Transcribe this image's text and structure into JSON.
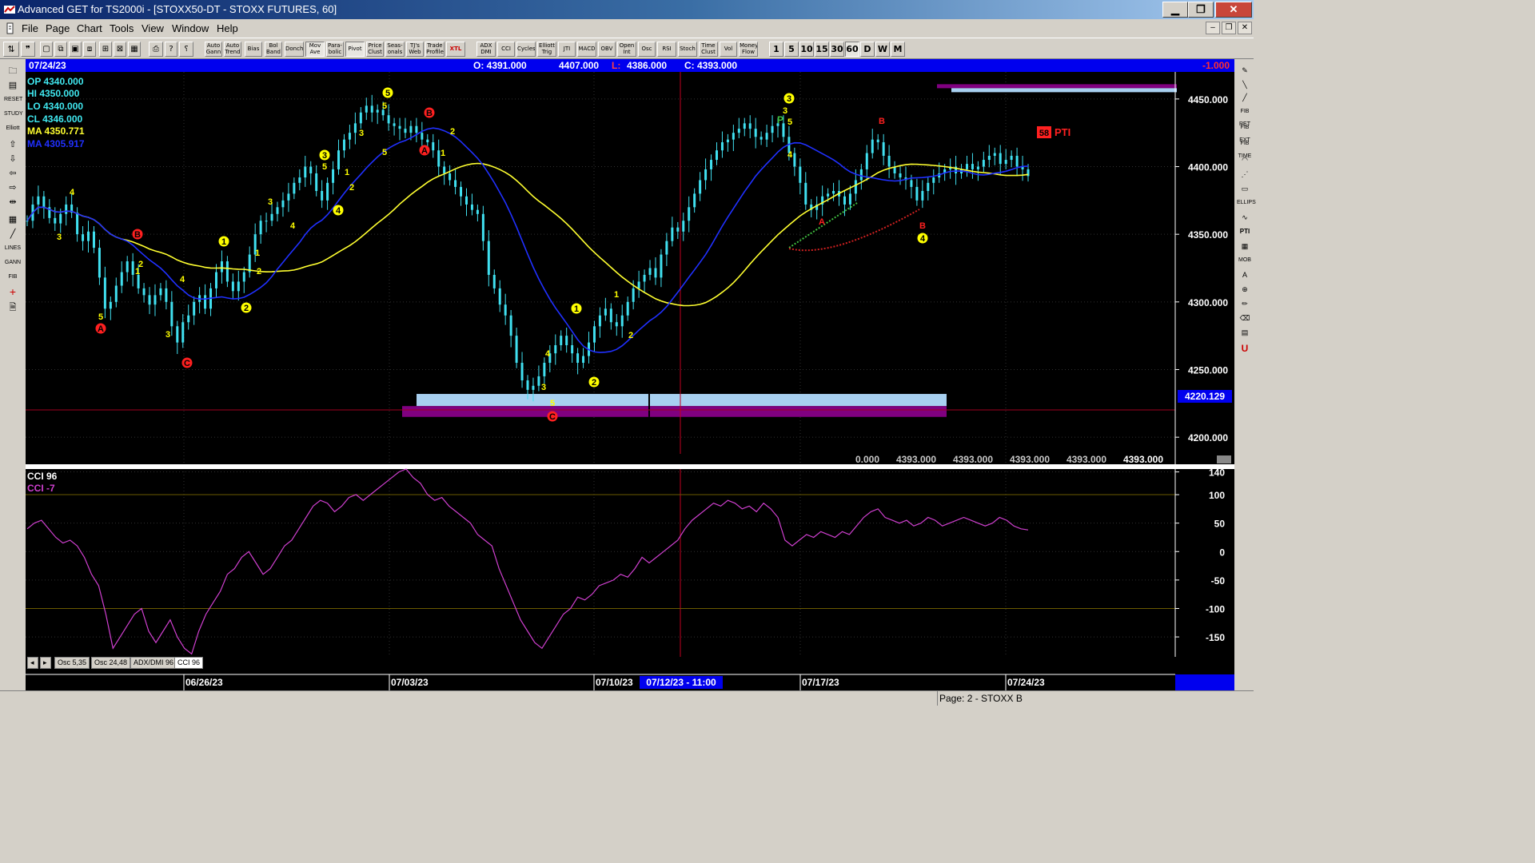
{
  "window": {
    "title": "Advanced GET for TS2000i - [STOXX50-DT - STOXX FUTURES, 60]",
    "minimize": "▁",
    "restore": "❐",
    "close": "✕"
  },
  "menu": {
    "items": [
      "File",
      "Page",
      "Chart",
      "Tools",
      "View",
      "Window",
      "Help"
    ]
  },
  "toolbar": {
    "study_buttons": [
      "Auto Gann",
      "Auto Trend",
      "Bias",
      "Bol Band",
      "Donch",
      "Mov Ave",
      "Para-bolic",
      "Pivot",
      "Price Clust",
      "Seas-onals",
      "TJ's Web",
      "Trade Profile",
      "XTL",
      "ADX DMI",
      "CCI",
      "Cycles",
      "Elliott Trig",
      "JTI",
      "MACD",
      "OBV",
      "Open Int",
      "Osc",
      "RSI",
      "Stoch",
      "Time Clust",
      "Vol",
      "Money Flow"
    ],
    "periods": [
      "1",
      "5",
      "10",
      "15",
      "30",
      "60",
      "D",
      "W",
      "M"
    ],
    "active_period": "60"
  },
  "header": {
    "date": "07/24/23",
    "open": "O: 4391.000",
    "high": "4407.000",
    "low_label": "L:",
    "low": "4386.000",
    "close": "C: 4393.000",
    "change": "-1.000"
  },
  "info_box": {
    "op": "OP  4340.000",
    "hi": "HI   4350.000",
    "lo": "LO  4340.000",
    "cl": "CL  4346.000",
    "ma1": "MA  4350.771",
    "ma2": "MA  4305.917"
  },
  "price_axis": {
    "ticks": [
      "4450.000",
      "4400.000",
      "4350.000",
      "4300.000",
      "4250.000",
      "4200.000"
    ],
    "marker_label": "4220.129"
  },
  "footer_values": [
    "0.000",
    "4393.000",
    "4393.000",
    "4393.000",
    "4393.000",
    "4393.000"
  ],
  "pti": {
    "value": "58",
    "label": "PTI"
  },
  "cci": {
    "title": "CCI 96",
    "value_label": "CCI  -7",
    "ticks": [
      "140",
      "100",
      "50",
      "0",
      "-50",
      "-100",
      "-150"
    ]
  },
  "indicator_tabs": [
    "Osc 5,35",
    "Osc 24,48",
    "ADX/DMI 96",
    "CCI 96"
  ],
  "date_axis": [
    "06/26/23",
    "07/03/23",
    "07/10/23",
    "07/17/23",
    "07/24/23"
  ],
  "cursor_date": "07/12/23 - 11:00",
  "status": {
    "page": "Page: 2 - STOXX B"
  },
  "colors": {
    "background": "#000000",
    "candles": "#40e0f0",
    "ma_fast": "#ffff30",
    "ma_slow": "#2030ff",
    "cci_line": "#d040d0",
    "elliott_labels": "#ffff00",
    "abc_labels": "#ff2020",
    "target_box_light": "#a8d0f0",
    "target_box_dark": "#800080"
  },
  "chart_data": {
    "type": "candlestick",
    "title": "STOXX50-DT - STOXX FUTURES, 60",
    "x_dates": [
      "06/26/23",
      "07/03/23",
      "07/10/23",
      "07/17/23",
      "07/24/23"
    ],
    "ylim": [
      4180,
      4470
    ],
    "close_series": [
      4360,
      4372,
      4378,
      4370,
      4362,
      4358,
      4365,
      4372,
      4366,
      4350,
      4345,
      4352,
      4340,
      4318,
      4295,
      4300,
      4312,
      4322,
      4330,
      4320,
      4310,
      4305,
      4298,
      4305,
      4310,
      4300,
      4282,
      4270,
      4285,
      4290,
      4300,
      4305,
      4295,
      4310,
      4322,
      4330,
      4315,
      4308,
      4315,
      4322,
      4335,
      4350,
      4360,
      4360,
      4365,
      4370,
      4375,
      4380,
      4388,
      4392,
      4400,
      4395,
      4382,
      4375,
      4388,
      4398,
      4412,
      4420,
      4425,
      4432,
      4440,
      4445,
      4440,
      4442,
      4438,
      4432,
      4430,
      4428,
      4425,
      4430,
      4425,
      4420,
      4418,
      4412,
      4400,
      4395,
      4390,
      4385,
      4378,
      4372,
      4368,
      4365,
      4345,
      4320,
      4310,
      4298,
      4290,
      4275,
      4255,
      4242,
      4235,
      4238,
      4245,
      4255,
      4262,
      4268,
      4275,
      4268,
      4262,
      4255,
      4260,
      4270,
      4282,
      4290,
      4295,
      4285,
      4282,
      4290,
      4300,
      4310,
      4315,
      4320,
      4325,
      4318,
      4335,
      4345,
      4355,
      4352,
      4360,
      4370,
      4380,
      4390,
      4398,
      4405,
      4412,
      4418,
      4420,
      4425,
      4428,
      4432,
      4428,
      4422,
      4420,
      4425,
      4430,
      4432,
      4422,
      4410,
      4400,
      4388,
      4372,
      4368,
      4372,
      4378,
      4380,
      4382,
      4378,
      4372,
      4380,
      4390,
      4398,
      4410,
      4420,
      4418,
      4408,
      4400,
      4395,
      4392,
      4390,
      4385,
      4375,
      4382,
      4388,
      4392,
      4395,
      4398,
      4400,
      4395,
      4398,
      4402,
      4398,
      4400,
      4405,
      4408,
      4410,
      4402,
      4405,
      4408,
      4400,
      4398,
      4393
    ],
    "ma_fast": {
      "name": "MA",
      "last": 4350.771
    },
    "ma_slow": {
      "name": "MA",
      "last": 4305.917
    },
    "target_zone": {
      "upper": 4232,
      "lower": 4215,
      "line": 4220.129
    },
    "upper_band_marker": 4455,
    "cci": {
      "period": 96,
      "ylim": [
        -185,
        145
      ],
      "values": [
        40,
        50,
        55,
        40,
        25,
        15,
        20,
        10,
        -10,
        -40,
        -60,
        -110,
        -170,
        -150,
        -130,
        -110,
        -100,
        -140,
        -160,
        -140,
        -120,
        -150,
        -170,
        -180,
        -140,
        -110,
        -90,
        -70,
        -40,
        -30,
        -10,
        0,
        -20,
        -40,
        -30,
        -10,
        10,
        20,
        40,
        60,
        80,
        90,
        85,
        70,
        80,
        95,
        100,
        90,
        100,
        110,
        120,
        130,
        140,
        145,
        130,
        120,
        100,
        90,
        95,
        80,
        70,
        60,
        50,
        30,
        20,
        10,
        -30,
        -60,
        -90,
        -120,
        -140,
        -160,
        -170,
        -150,
        -130,
        -110,
        -100,
        -80,
        -85,
        -75,
        -60,
        -55,
        -50,
        -40,
        -45,
        -30,
        -10,
        -20,
        -10,
        0,
        10,
        20,
        40,
        55,
        65,
        75,
        85,
        80,
        90,
        85,
        75,
        80,
        70,
        85,
        75,
        60,
        20,
        10,
        20,
        30,
        25,
        35,
        30,
        25,
        35,
        30,
        45,
        60,
        70,
        75,
        60,
        55,
        50,
        55,
        45,
        50,
        60,
        55,
        45,
        50,
        55,
        60,
        55,
        50,
        45,
        50,
        60,
        55,
        45,
        40,
        38
      ]
    }
  }
}
